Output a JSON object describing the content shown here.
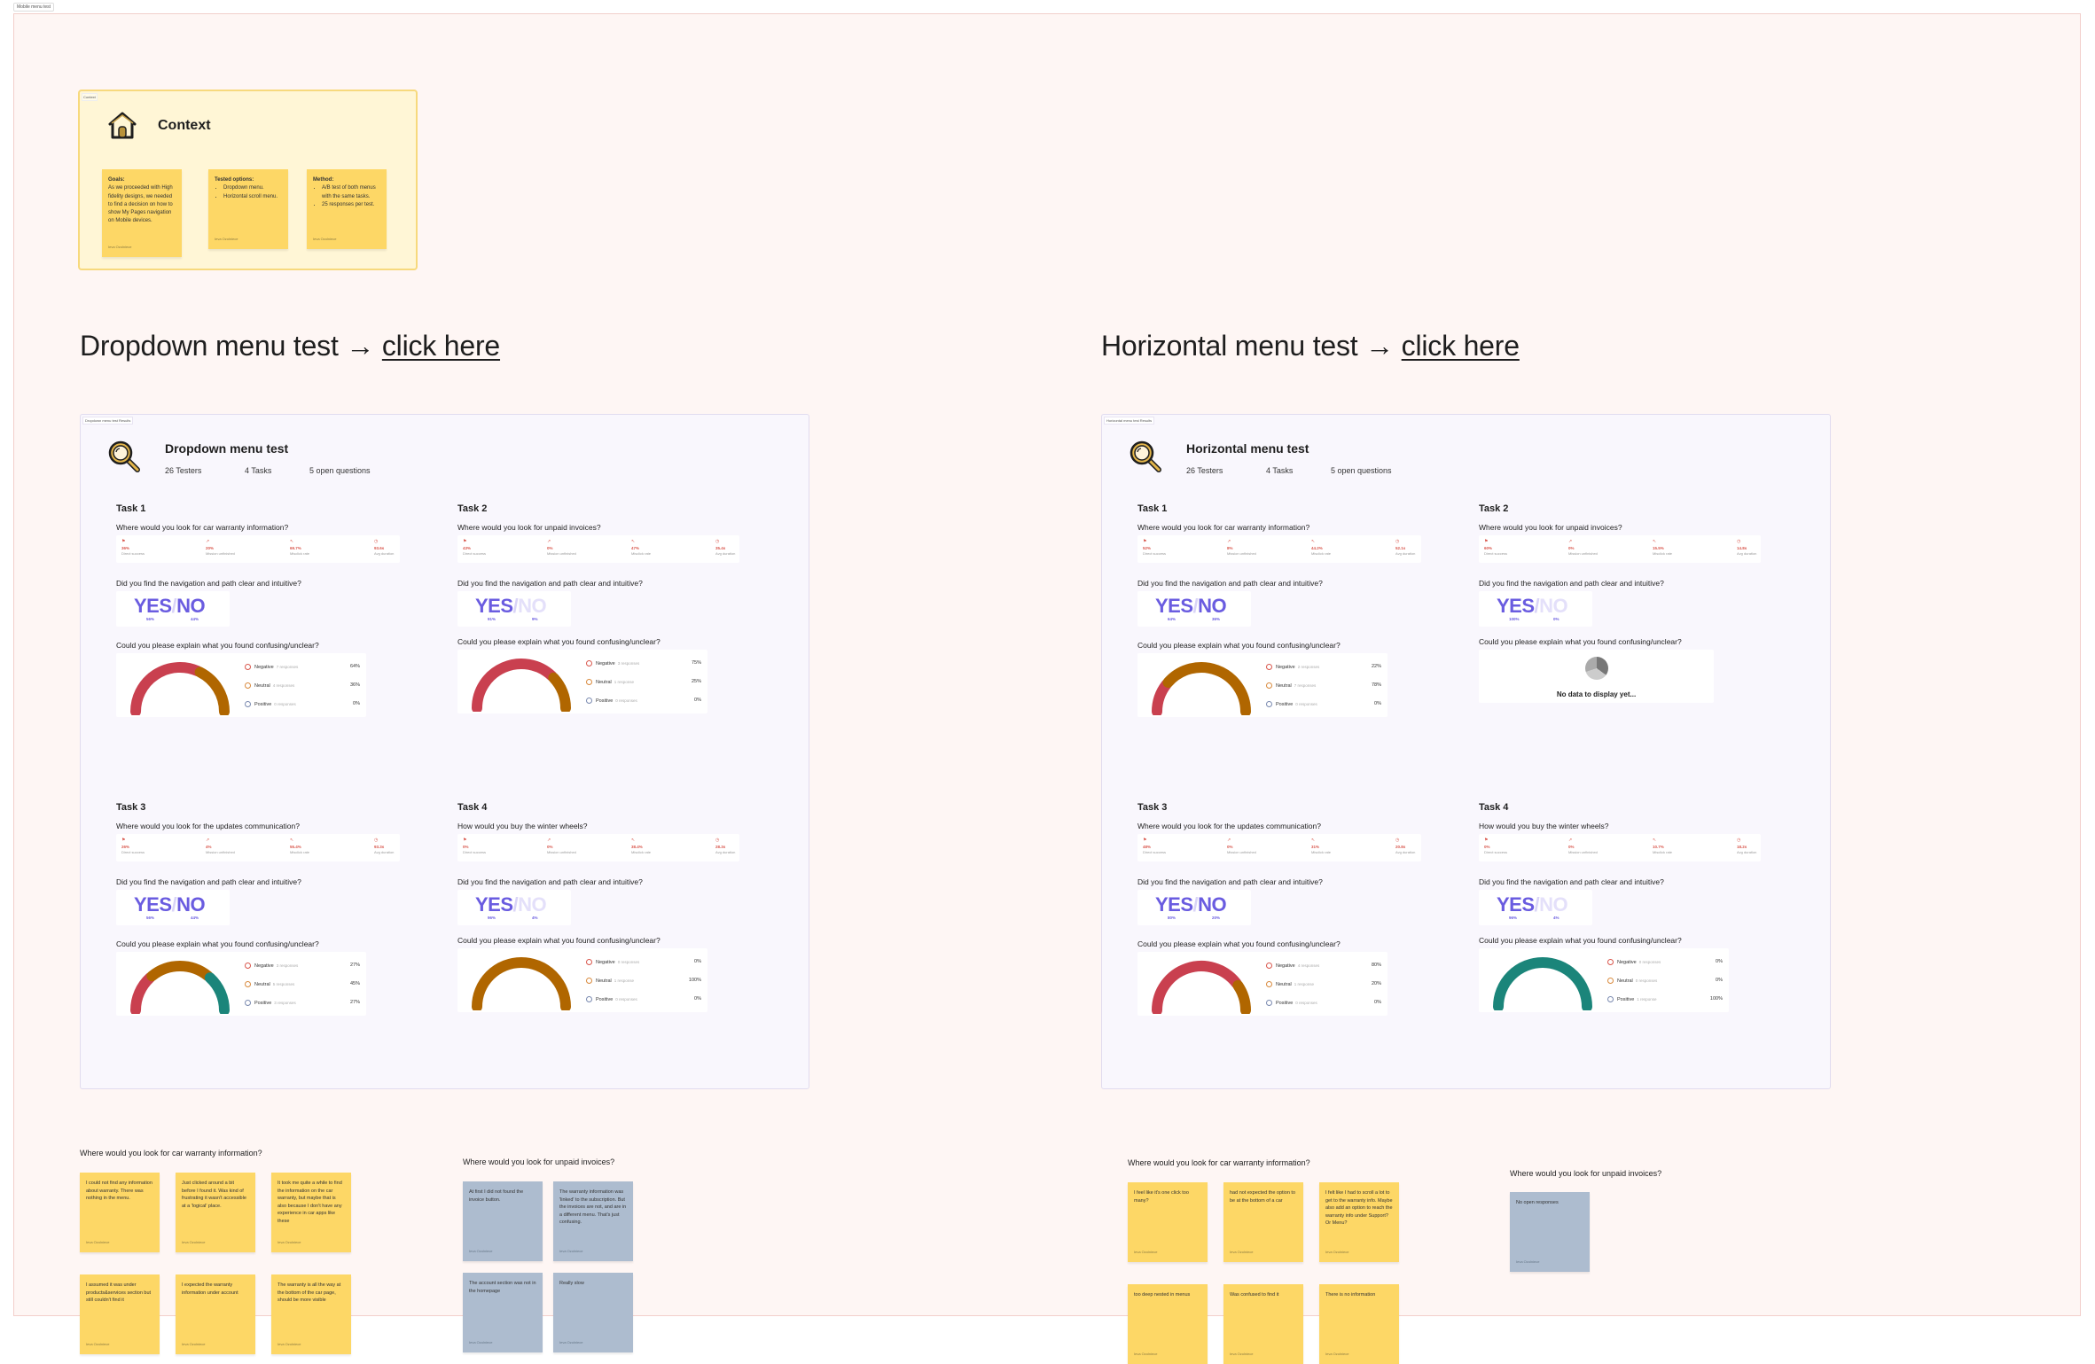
{
  "board": {
    "frame_label": "Mobile menu test"
  },
  "context": {
    "label": "Context",
    "title": "Context",
    "notes": [
      {
        "heading": "Goals:",
        "text": "As we proceeded with High fidelity designs, we needed to find a decision on how to show My Pages navigation on Mobile devices.",
        "author": "Ieva Ozolniece"
      },
      {
        "heading": "Tested options:",
        "bullets": [
          "Dropdown menu.",
          "Horizontal scroll menu."
        ],
        "author": "Ieva Ozolniece"
      },
      {
        "heading": "Method:",
        "bullets": [
          "A/B test of both menus with the same tasks.",
          "25 responses per test."
        ],
        "author": "Ieva Ozolniece"
      }
    ]
  },
  "headings": {
    "dropdown": {
      "text": "Dropdown menu test → ",
      "link": "click here"
    },
    "horizontal": {
      "text": "Horizontal menu test → ",
      "link": "click here"
    }
  },
  "colors": {
    "negative": "#c9404f",
    "neutral": "#b06600",
    "positive": "#1b857a",
    "yes": "#6a5ce0",
    "sticky_yellow": "#fdd766",
    "sticky_blue": "#adbccf"
  },
  "common": {
    "nav_question": "Did you find the navigation and path clear and intuitive?",
    "explain_question": "Could you please explain what you found confusing/unclear?",
    "metric_labels": [
      "Direct success",
      "Mission unfinished",
      "Misclick rate",
      "Avg duration"
    ],
    "sentiment_labels": [
      "Negative",
      "Neutral",
      "Positive"
    ],
    "no_data": "No data to display yet..."
  },
  "panels": [
    {
      "label": "Dropdown menu test Results",
      "title": "Dropdown menu test",
      "stats": [
        "26 Testers",
        "4 Tasks",
        "5 open questions"
      ],
      "tasks": [
        {
          "title": "Task 1",
          "question": "Where would you look for car warranty information?",
          "metrics": [
            "36%",
            "20%",
            "69.7%",
            "93.6s"
          ],
          "yes_pct": "56%",
          "no_pct": "44%",
          "yes": 0.56,
          "sentiment": [
            {
              "count": "7 responses",
              "pct": "64%",
              "value": 64
            },
            {
              "count": "4 responses",
              "pct": "36%",
              "value": 36
            },
            {
              "count": "0 responses",
              "pct": "0%",
              "value": 0
            }
          ]
        },
        {
          "title": "Task 2",
          "question": "Where would you look for unpaid invoices?",
          "metrics": [
            "43%",
            "0%",
            "47%",
            "35.4s"
          ],
          "yes_pct": "91%",
          "no_pct": "9%",
          "yes": 0.91,
          "sentiment": [
            {
              "count": "3 responses",
              "pct": "75%",
              "value": 75
            },
            {
              "count": "1 response",
              "pct": "25%",
              "value": 25
            },
            {
              "count": "0 responses",
              "pct": "0%",
              "value": 0
            }
          ]
        },
        {
          "title": "Task 3",
          "question": "Where would you look for the updates communication?",
          "metrics": [
            "26%",
            "4%",
            "55.4%",
            "93.3s"
          ],
          "yes_pct": "56%",
          "no_pct": "44%",
          "yes": 0.56,
          "sentiment": [
            {
              "count": "3 responses",
              "pct": "27%",
              "value": 27
            },
            {
              "count": "5 responses",
              "pct": "45%",
              "value": 45
            },
            {
              "count": "3 responses",
              "pct": "27%",
              "value": 27
            }
          ]
        },
        {
          "title": "Task 4",
          "question": "How would you buy the winter wheels?",
          "metrics": [
            "0%",
            "0%",
            "38.4%",
            "28.3s"
          ],
          "yes_pct": "96%",
          "no_pct": "4%",
          "yes": 0.96,
          "sentiment": [
            {
              "count": "0 responses",
              "pct": "0%",
              "value": 0
            },
            {
              "count": "1 response",
              "pct": "100%",
              "value": 100
            },
            {
              "count": "0 responses",
              "pct": "0%",
              "value": 0
            }
          ]
        }
      ]
    },
    {
      "label": "Horizontal menu test Results",
      "title": "Horizontal menu test",
      "stats": [
        "26 Testers",
        "4 Tasks",
        "5 open questions"
      ],
      "tasks": [
        {
          "title": "Task 1",
          "question": "Where would you look for car warranty information?",
          "metrics": [
            "52%",
            "8%",
            "44.2%",
            "52.1s"
          ],
          "yes_pct": "64%",
          "no_pct": "36%",
          "yes": 0.64,
          "sentiment": [
            {
              "count": "2 responses",
              "pct": "22%",
              "value": 22
            },
            {
              "count": "7 responses",
              "pct": "78%",
              "value": 78
            },
            {
              "count": "0 responses",
              "pct": "0%",
              "value": 0
            }
          ]
        },
        {
          "title": "Task 2",
          "question": "Where would you look for unpaid invoices?",
          "metrics": [
            "60%",
            "0%",
            "15.5%",
            "14.8s"
          ],
          "yes_pct": "100%",
          "no_pct": "0%",
          "yes": 1.0,
          "no_data": true
        },
        {
          "title": "Task 3",
          "question": "Where would you look for the updates communication?",
          "metrics": [
            "48%",
            "0%",
            "31%",
            "20.8s"
          ],
          "yes_pct": "80%",
          "no_pct": "20%",
          "yes": 0.8,
          "sentiment": [
            {
              "count": "4 responses",
              "pct": "80%",
              "value": 80
            },
            {
              "count": "1 response",
              "pct": "20%",
              "value": 20
            },
            {
              "count": "0 responses",
              "pct": "0%",
              "value": 0
            }
          ]
        },
        {
          "title": "Task 4",
          "question": "How would you buy the winter wheels?",
          "metrics": [
            "0%",
            "0%",
            "10.7%",
            "18.2s"
          ],
          "yes_pct": "96%",
          "no_pct": "4%",
          "yes": 0.96,
          "sentiment": [
            {
              "count": "0 responses",
              "pct": "0%",
              "value": 0
            },
            {
              "count": "0 responses",
              "pct": "0%",
              "value": 0
            },
            {
              "count": "1 response",
              "pct": "100%",
              "value": 100
            }
          ]
        }
      ]
    }
  ],
  "open_responses": [
    {
      "question": "Where would you look for car warranty information?",
      "color": "yellow",
      "notes": [
        "I could not find any information about warranty. There was nothing in the menu.",
        "Just clicked around a bit before I found it. Was kind of frustrating it wasn't accessible at a 'logical' place.",
        "It took me quite a while to find the information on the car warranty, but maybe that is also because I don't have any experience in car apps like these",
        "I assumed it was under products&services section but still couldn't find it",
        "I expected the warranty information under account",
        "The warranty is all the way at the bottom of the car page, should be more visible"
      ],
      "author": "Ieva Ozolniece"
    },
    {
      "question": "Where would you look for unpaid invoices?",
      "color": "blue",
      "notes": [
        "At first I did not found the invoice button.",
        "The warranty information was 'linked' to the subscription. But the invoices are not, and are in a different menu. That's just confusing.",
        "The account section was not in the homepage",
        "Really slow"
      ],
      "author": "Ieva Ozolniece"
    },
    {
      "question": "Where would you look for car warranty information?",
      "color": "yellow",
      "notes": [
        "I feel like it's one click too many?",
        "had not expected the option to be at the bottom of a car",
        "I felt like I had to scroll a lot to get to the warranty info. Maybe also add an option to reach the warranty info under Support? Or Menu?",
        "too deep nested in menus",
        "Was confused to find it",
        "There is no information"
      ],
      "author": "Ieva Ozolniece"
    },
    {
      "question": "Where would you look for unpaid invoices?",
      "color": "blue",
      "notes": [
        "No open responses"
      ],
      "author": "Ieva Ozolniece"
    }
  ]
}
